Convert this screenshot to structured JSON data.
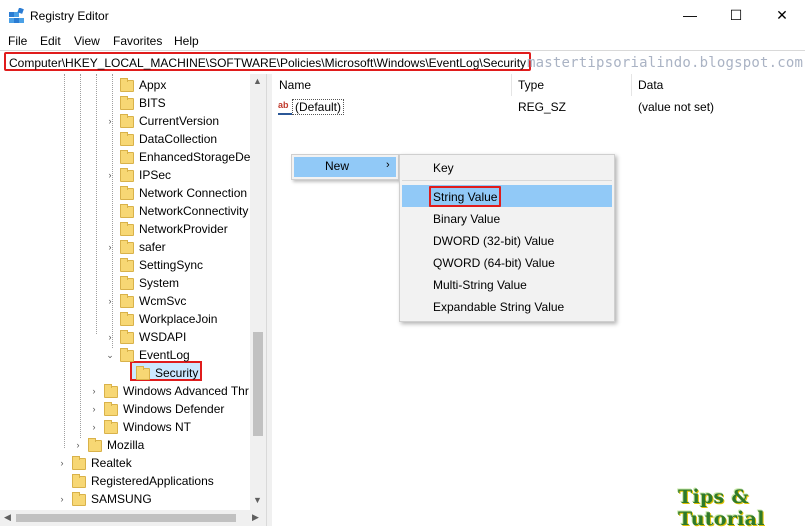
{
  "window": {
    "title": "Registry Editor",
    "buttons": {
      "minimize": "—",
      "maximize": "☐",
      "close": "✕"
    }
  },
  "menu": [
    "File",
    "Edit",
    "View",
    "Favorites",
    "Help"
  ],
  "address": "Computer\\HKEY_LOCAL_MACHINE\\SOFTWARE\\Policies\\Microsoft\\Windows\\EventLog\\Security",
  "watermark": "mastertipsorialindo.blogspot.com",
  "tree": {
    "items": [
      {
        "label": "Appx",
        "expander": ""
      },
      {
        "label": "BITS",
        "expander": ""
      },
      {
        "label": "CurrentVersion",
        "expander": "›"
      },
      {
        "label": "DataCollection",
        "expander": ""
      },
      {
        "label": "EnhancedStorageDev",
        "expander": ""
      },
      {
        "label": "IPSec",
        "expander": "›"
      },
      {
        "label": "Network Connection",
        "expander": ""
      },
      {
        "label": "NetworkConnectivity",
        "expander": ""
      },
      {
        "label": "NetworkProvider",
        "expander": ""
      },
      {
        "label": "safer",
        "expander": "›"
      },
      {
        "label": "SettingSync",
        "expander": ""
      },
      {
        "label": "System",
        "expander": ""
      },
      {
        "label": "WcmSvc",
        "expander": "›"
      },
      {
        "label": "WorkplaceJoin",
        "expander": ""
      },
      {
        "label": "WSDAPI",
        "expander": "›"
      },
      {
        "label": "EventLog",
        "expander": "⌄"
      },
      {
        "label": "Security",
        "expander": ""
      },
      {
        "label": "Windows Advanced Thr",
        "expander": "›"
      },
      {
        "label": "Windows Defender",
        "expander": "›"
      },
      {
        "label": "Windows NT",
        "expander": "›"
      },
      {
        "label": "Mozilla",
        "expander": "›"
      },
      {
        "label": "Realtek",
        "expander": "›"
      },
      {
        "label": "RegisteredApplications",
        "expander": ""
      },
      {
        "label": "SAMSUNG",
        "expander": "›"
      }
    ]
  },
  "list": {
    "columns": [
      "Name",
      "Type",
      "Data"
    ],
    "rows": [
      {
        "name": "(Default)",
        "type": "REG_SZ",
        "data": "(value not set)",
        "icon": "ab"
      }
    ]
  },
  "context_menu": {
    "new_label": "New",
    "arrow": "›",
    "submenu": [
      "Key",
      "String Value",
      "Binary Value",
      "DWORD (32-bit) Value",
      "QWORD (64-bit) Value",
      "Multi-String Value",
      "Expandable String Value"
    ]
  },
  "logo": "Tips & Tutorial",
  "colors": {
    "highlight_red": "#e01c1c",
    "menu_hover": "#91c9f7",
    "selection": "#cce8ff"
  }
}
